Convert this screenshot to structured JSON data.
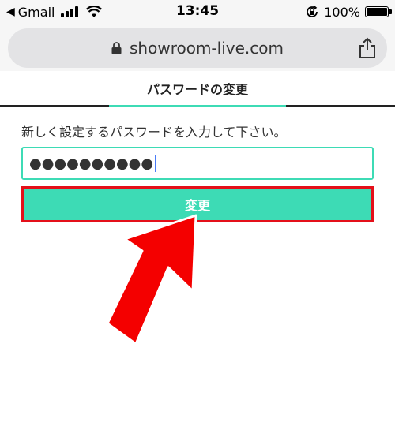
{
  "status_bar": {
    "carrier": "Gmail",
    "time": "13:45",
    "battery": "100%",
    "icons": [
      "signal-icon",
      "wifi-icon",
      "orientation-lock-icon",
      "battery-icon"
    ]
  },
  "browser": {
    "url": "showroom-live.com",
    "icons": [
      "lock-icon",
      "share-icon"
    ]
  },
  "page": {
    "title": "パスワードの変更",
    "instruction": "新しく設定するパスワードを入力して下さい。",
    "password_value": "●●●●●●●●●●",
    "submit_label": "変更"
  },
  "colors": {
    "accent": "#3ddbb5",
    "highlight": "#e4101a",
    "caret": "#4a7cf7"
  }
}
